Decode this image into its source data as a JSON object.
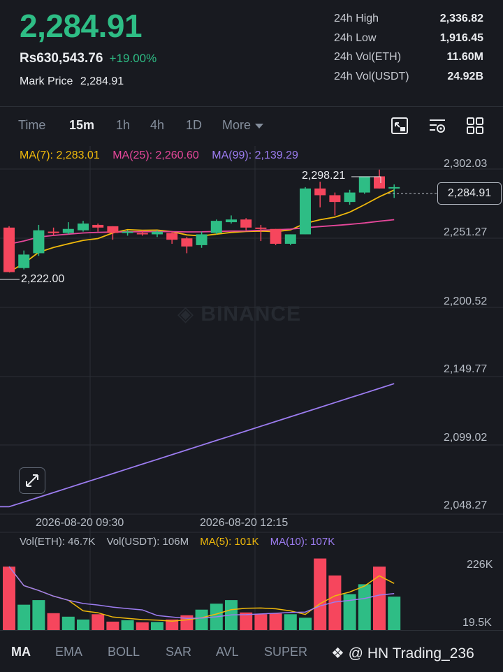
{
  "ticker": {
    "last_price": "2,284.91",
    "fiat_price": "Rs630,543.76",
    "change_pct": "+19.00%",
    "mark_label": "Mark Price",
    "mark_price": "2,284.91",
    "stats": [
      {
        "label": "24h High",
        "value": "2,336.82"
      },
      {
        "label": "24h Low",
        "value": "1,916.45"
      },
      {
        "label": "24h Vol(ETH)",
        "value": "11.60M"
      },
      {
        "label": "24h Vol(USDT)",
        "value": "24.92B"
      }
    ]
  },
  "toolbar": {
    "intervals": [
      "Time",
      "15m",
      "1h",
      "4h",
      "1D"
    ],
    "active_interval": "15m",
    "more_label": "More",
    "icons": [
      "fullscreen-chart-icon",
      "chart-settings-icon",
      "grid-layout-icon"
    ]
  },
  "ma_legend": {
    "ma7": "MA(7): 2,283.01",
    "ma25": "MA(25): 2,260.60",
    "ma99": "MA(99): 2,139.29"
  },
  "price_axis": [
    "2,302.03",
    "2,251.27",
    "2,200.52",
    "2,149.77",
    "2,099.02",
    "2,048.27"
  ],
  "current_price_tag": "2,284.91",
  "high_label": "2,298.21",
  "low_label": "2,222.00",
  "watermark": "BINANCE",
  "time_axis": [
    "2026-08-20 09:30",
    "2026-08-20 12:15"
  ],
  "vol_legend": {
    "vol_eth": "Vol(ETH): 46.7K",
    "vol_usdt": "Vol(USDT): 106M",
    "ma5": "MA(5): 101K",
    "ma10": "MA(10): 107K"
  },
  "vol_axis": [
    "226K",
    "19.5K"
  ],
  "indicator_tabs": [
    "MA",
    "EMA",
    "BOLL",
    "SAR",
    "AVL",
    "SUPER"
  ],
  "active_indicator": "MA",
  "creator": "@ HN Trading_236",
  "colors": {
    "up": "#2ebd85",
    "down": "#f6465d",
    "ma7": "#f0b90b",
    "ma25": "#e6479a",
    "ma99": "#9c7cf0",
    "background": "#181a20"
  },
  "chart_data": {
    "type": "candlestick",
    "interval": "15m",
    "price_range": [
      2040,
      2310
    ],
    "candles": [
      {
        "o": 2255,
        "h": 2256,
        "c": 2222,
        "l": 2222
      },
      {
        "o": 2225,
        "h": 2238,
        "c": 2235,
        "l": 2224
      },
      {
        "o": 2236,
        "h": 2257,
        "c": 2253,
        "l": 2234
      },
      {
        "o": 2252,
        "h": 2255,
        "c": 2251,
        "l": 2249
      },
      {
        "o": 2251,
        "h": 2259,
        "c": 2254,
        "l": 2250
      },
      {
        "o": 2253,
        "h": 2260,
        "c": 2258,
        "l": 2252
      },
      {
        "o": 2257,
        "h": 2258,
        "c": 2255,
        "l": 2252
      },
      {
        "o": 2256,
        "h": 2256,
        "c": 2251,
        "l": 2246
      },
      {
        "o": 2251,
        "h": 2253,
        "c": 2252,
        "l": 2249
      },
      {
        "o": 2251,
        "h": 2253,
        "c": 2250,
        "l": 2249
      },
      {
        "o": 2250,
        "h": 2253,
        "c": 2252,
        "l": 2248
      },
      {
        "o": 2251,
        "h": 2252,
        "c": 2246,
        "l": 2243
      },
      {
        "o": 2247,
        "h": 2248,
        "c": 2241,
        "l": 2236
      },
      {
        "o": 2242,
        "h": 2252,
        "c": 2250,
        "l": 2240
      },
      {
        "o": 2251,
        "h": 2261,
        "c": 2260,
        "l": 2250
      },
      {
        "o": 2259,
        "h": 2264,
        "c": 2261,
        "l": 2258
      },
      {
        "o": 2261,
        "h": 2262,
        "c": 2255,
        "l": 2253
      },
      {
        "o": 2255,
        "h": 2257,
        "c": 2254,
        "l": 2245
      },
      {
        "o": 2254,
        "h": 2254,
        "c": 2243,
        "l": 2242
      },
      {
        "o": 2243,
        "h": 2250,
        "c": 2250,
        "l": 2242
      },
      {
        "o": 2250,
        "h": 2285,
        "c": 2284,
        "l": 2250
      },
      {
        "o": 2284,
        "h": 2289,
        "c": 2279,
        "l": 2270
      },
      {
        "o": 2279,
        "h": 2281,
        "c": 2274,
        "l": 2264
      },
      {
        "o": 2274,
        "h": 2283,
        "c": 2281,
        "l": 2272
      },
      {
        "o": 2281,
        "h": 2290,
        "c": 2293,
        "l": 2280
      },
      {
        "o": 2293,
        "h": 2298,
        "c": 2284,
        "l": 2284
      },
      {
        "o": 2284,
        "h": 2287,
        "c": 2285,
        "l": 2277
      }
    ],
    "volumes": [
      180,
      72,
      85,
      48,
      38,
      30,
      45,
      24,
      28,
      22,
      23,
      30,
      42,
      58,
      75,
      85,
      50,
      45,
      47,
      45,
      35,
      203,
      155,
      102,
      130,
      180,
      95
    ]
  }
}
